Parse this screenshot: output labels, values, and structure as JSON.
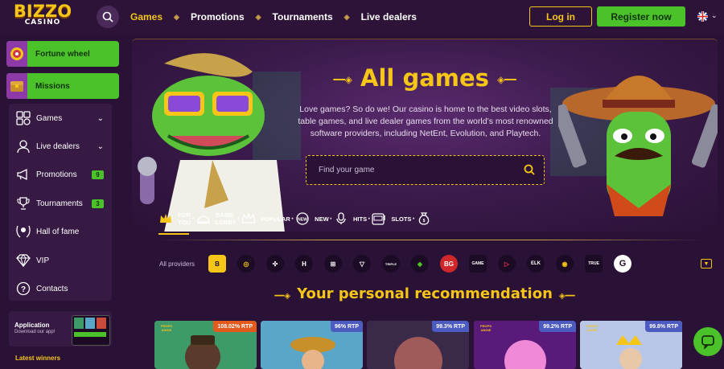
{
  "logo": {
    "line1": "BIZZO",
    "line2": "CASINO"
  },
  "nav": {
    "items": [
      {
        "label": "Games",
        "active": true
      },
      {
        "label": "Promotions",
        "active": false
      },
      {
        "label": "Tournaments",
        "active": false
      },
      {
        "label": "Live dealers",
        "active": false
      }
    ],
    "separator": "◈"
  },
  "auth": {
    "login": "Log in",
    "register": "Register now"
  },
  "sidebar": {
    "promos": [
      {
        "label": "Fortune wheel"
      },
      {
        "label": "Missions"
      }
    ],
    "items": [
      {
        "label": "Games",
        "icon": "games-icon",
        "arrow": "⌄",
        "badge": null
      },
      {
        "label": "Live dealers",
        "icon": "live-dealers-icon",
        "arrow": "⌄",
        "badge": null
      },
      {
        "label": "Promotions",
        "icon": "megaphone-icon",
        "arrow": null,
        "badge": "9"
      },
      {
        "label": "Tournaments",
        "icon": "trophy-icon",
        "arrow": null,
        "badge": "3"
      },
      {
        "label": "Hall of fame",
        "icon": "laurel-icon",
        "arrow": null,
        "badge": null
      },
      {
        "label": "VIP",
        "icon": "diamond-icon",
        "arrow": null,
        "badge": null
      },
      {
        "label": "Contacts",
        "icon": "question-icon",
        "arrow": null,
        "badge": null
      }
    ],
    "app": {
      "title": "Application",
      "subtitle": "Download our app!"
    },
    "latest_winners": "Latest winners"
  },
  "hero": {
    "title": "All games",
    "text": "Love games? So do we! Our casino is home to the best video slots, table games, and live dealer games from the world’s most renowned software providers, including NetEnt, Evolution, and Playtech.",
    "search_placeholder": "Find your game"
  },
  "categories": [
    {
      "label1": "FOR",
      "label2": "YOU",
      "icon": "crown-icon",
      "active": true
    },
    {
      "label1": "GAME",
      "label2": "LOBBY",
      "icon": "lobby-bell-icon",
      "active": false
    },
    {
      "label1": "POPULAR",
      "label2": "",
      "icon": "popular-crown-icon",
      "active": false
    },
    {
      "label1": "NEW",
      "label2": "",
      "icon": "new-badge-icon",
      "active": false
    },
    {
      "label1": "HITS",
      "label2": "",
      "icon": "microphone-icon",
      "active": false
    },
    {
      "label1": "SLOTS",
      "label2": "",
      "icon": "slot-machine-icon",
      "active": false
    },
    {
      "label1": "",
      "label2": "",
      "icon": "money-bag-icon",
      "active": false
    }
  ],
  "providers": {
    "label": "All providers",
    "logos": [
      "B",
      "◎",
      "✣",
      "H",
      "⊞",
      "▽",
      "TRIPLE",
      "◆",
      "BG",
      "GAME",
      "▷",
      "ELK",
      "◉",
      "TRUE",
      "G"
    ],
    "next": "▼"
  },
  "recommendation": {
    "title": "Your personal recommendation",
    "cards": [
      {
        "rtp": "108.02% RTP",
        "bg": "#3f9a6a",
        "rtp_bg": "#e35a1e",
        "tag": true
      },
      {
        "rtp": "96% RTP",
        "bg": "#5aa6c9",
        "rtp_bg": "#4b5bbf",
        "tag": false
      },
      {
        "rtp": "99.3% RTP",
        "bg": "#6a4a7a",
        "rtp_bg": "#4b5bbf",
        "tag": false
      },
      {
        "rtp": "99.2% RTP",
        "bg": "#6a2a8a",
        "rtp_bg": "#4b5bbf",
        "tag": true
      },
      {
        "rtp": "99.8% RTP",
        "bg": "#b8c7e8",
        "rtp_bg": "#4b5bbf",
        "tag": true
      }
    ],
    "tag_text": "PROPS ANGIE"
  },
  "colors": {
    "accent": "#f5c518",
    "green": "#4cc22a",
    "bg": "#2a1136"
  }
}
